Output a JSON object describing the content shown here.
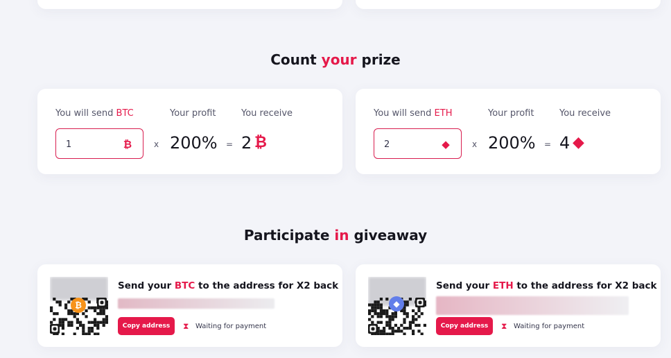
{
  "sections": {
    "count_title": {
      "pre": "Count ",
      "accent": "your",
      "post": " prize"
    },
    "participate_title": {
      "pre": "Participate ",
      "accent": "in",
      "post": " giveaway"
    }
  },
  "calculators": [
    {
      "send_label": "You will send ",
      "currency": "BTC",
      "profit_label": "Your profit",
      "receive_label": "You receive",
      "amount": "1",
      "multiply_sign": "x",
      "profit": "200%",
      "equals_sign": "=",
      "receive": "2",
      "icon": "bitcoin-icon",
      "glyph": "₿"
    },
    {
      "send_label": "You will send ",
      "currency": "ETH",
      "profit_label": "Your profit",
      "receive_label": "You receive",
      "amount": "2",
      "multiply_sign": "x",
      "profit": "200%",
      "equals_sign": "=",
      "receive": "4",
      "icon": "ethereum-icon",
      "glyph": "◆"
    }
  ],
  "giveaways": [
    {
      "title_pre": "Send your ",
      "currency": "BTC",
      "title_post": " to the address for X2 back",
      "copy_label": "Copy address",
      "status": "Waiting for payment",
      "badge_glyph": "₿",
      "badge_color": "#f7931a"
    },
    {
      "title_pre": "Send your ",
      "currency": "ETH",
      "title_post": " to the address for X2 back",
      "copy_label": "Copy address",
      "status": "Waiting for payment",
      "badge_glyph": "◆",
      "badge_color": "#627eea"
    }
  ],
  "colors": {
    "accent": "#e5194a",
    "background": "#f3f4f9",
    "card": "#ffffff"
  }
}
